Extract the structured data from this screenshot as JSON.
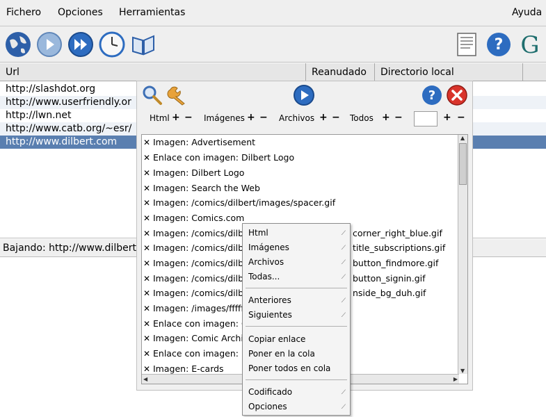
{
  "menubar": {
    "items": [
      "Fichero",
      "Opciones",
      "Herramientas"
    ],
    "help": "Ayuda"
  },
  "toolbar": {
    "icons": [
      "globe-icon",
      "start-icon",
      "fast-forward-icon",
      "clock-icon",
      "book-icon",
      "document-icon",
      "help-icon",
      "g-logo-icon"
    ]
  },
  "list": {
    "columns": [
      "Url",
      "Reanudado",
      "Directorio local"
    ],
    "rows": [
      "http://slashdot.org",
      "http://www.userfriendly.or",
      "http://lwn.net",
      "http://www.catb.org/~esr/",
      "http://www.dilbert.com"
    ],
    "selected_index": 4
  },
  "status": "Bajando: http://www.dilbert",
  "panel": {
    "filters": [
      {
        "label": "Html",
        "plus": "+",
        "minus": "−"
      },
      {
        "label": "Imágenes",
        "plus": "+",
        "minus": "−"
      },
      {
        "label": "Archivos",
        "plus": "+",
        "minus": "−"
      },
      {
        "label": "Todos",
        "plus": "+",
        "minus": "−"
      }
    ],
    "extra_plus": "+",
    "extra_minus": "−",
    "items": [
      "Imagen: Advertisement",
      "Enlace con imagen: Dilbert Logo",
      "Imagen: Dilbert Logo",
      "Imagen: Search the Web",
      "Imagen: /comics/dilbert/images/spacer.gif",
      "Imagen: Comics.com",
      "Imagen: /comics/dilber",
      "Imagen: /comics/dilber",
      "Imagen: /comics/dilber",
      "Imagen: /comics/dilber",
      "Imagen: /comics/dilber",
      "Imagen: /images/ffffff_c",
      "Enlace con imagen: Co",
      "Imagen: Comic Archive",
      "Enlace con imagen: E-c",
      "Imagen: E-cards"
    ],
    "item_suffixes": [
      "corner_right_blue.gif",
      "title_subscriptions.gif",
      "button_findmore.gif",
      "button_signin.gif",
      "nside_bg_duh.gif"
    ],
    "mark": "✕"
  },
  "context_menu": {
    "group1": [
      "Html",
      "Imágenes",
      "Archivos",
      "Todas..."
    ],
    "group2": [
      "Anteriores",
      "Siguientes"
    ],
    "group3": [
      "Copiar enlace",
      "Poner en la cola",
      "Poner todos en cola"
    ],
    "group4": [
      "Codificado",
      "Opciones"
    ]
  },
  "colors": {
    "selection": "#5a7fb0",
    "alt_row": "#eef2f7",
    "stop": "#d9342b",
    "blue": "#2d6cc0"
  }
}
